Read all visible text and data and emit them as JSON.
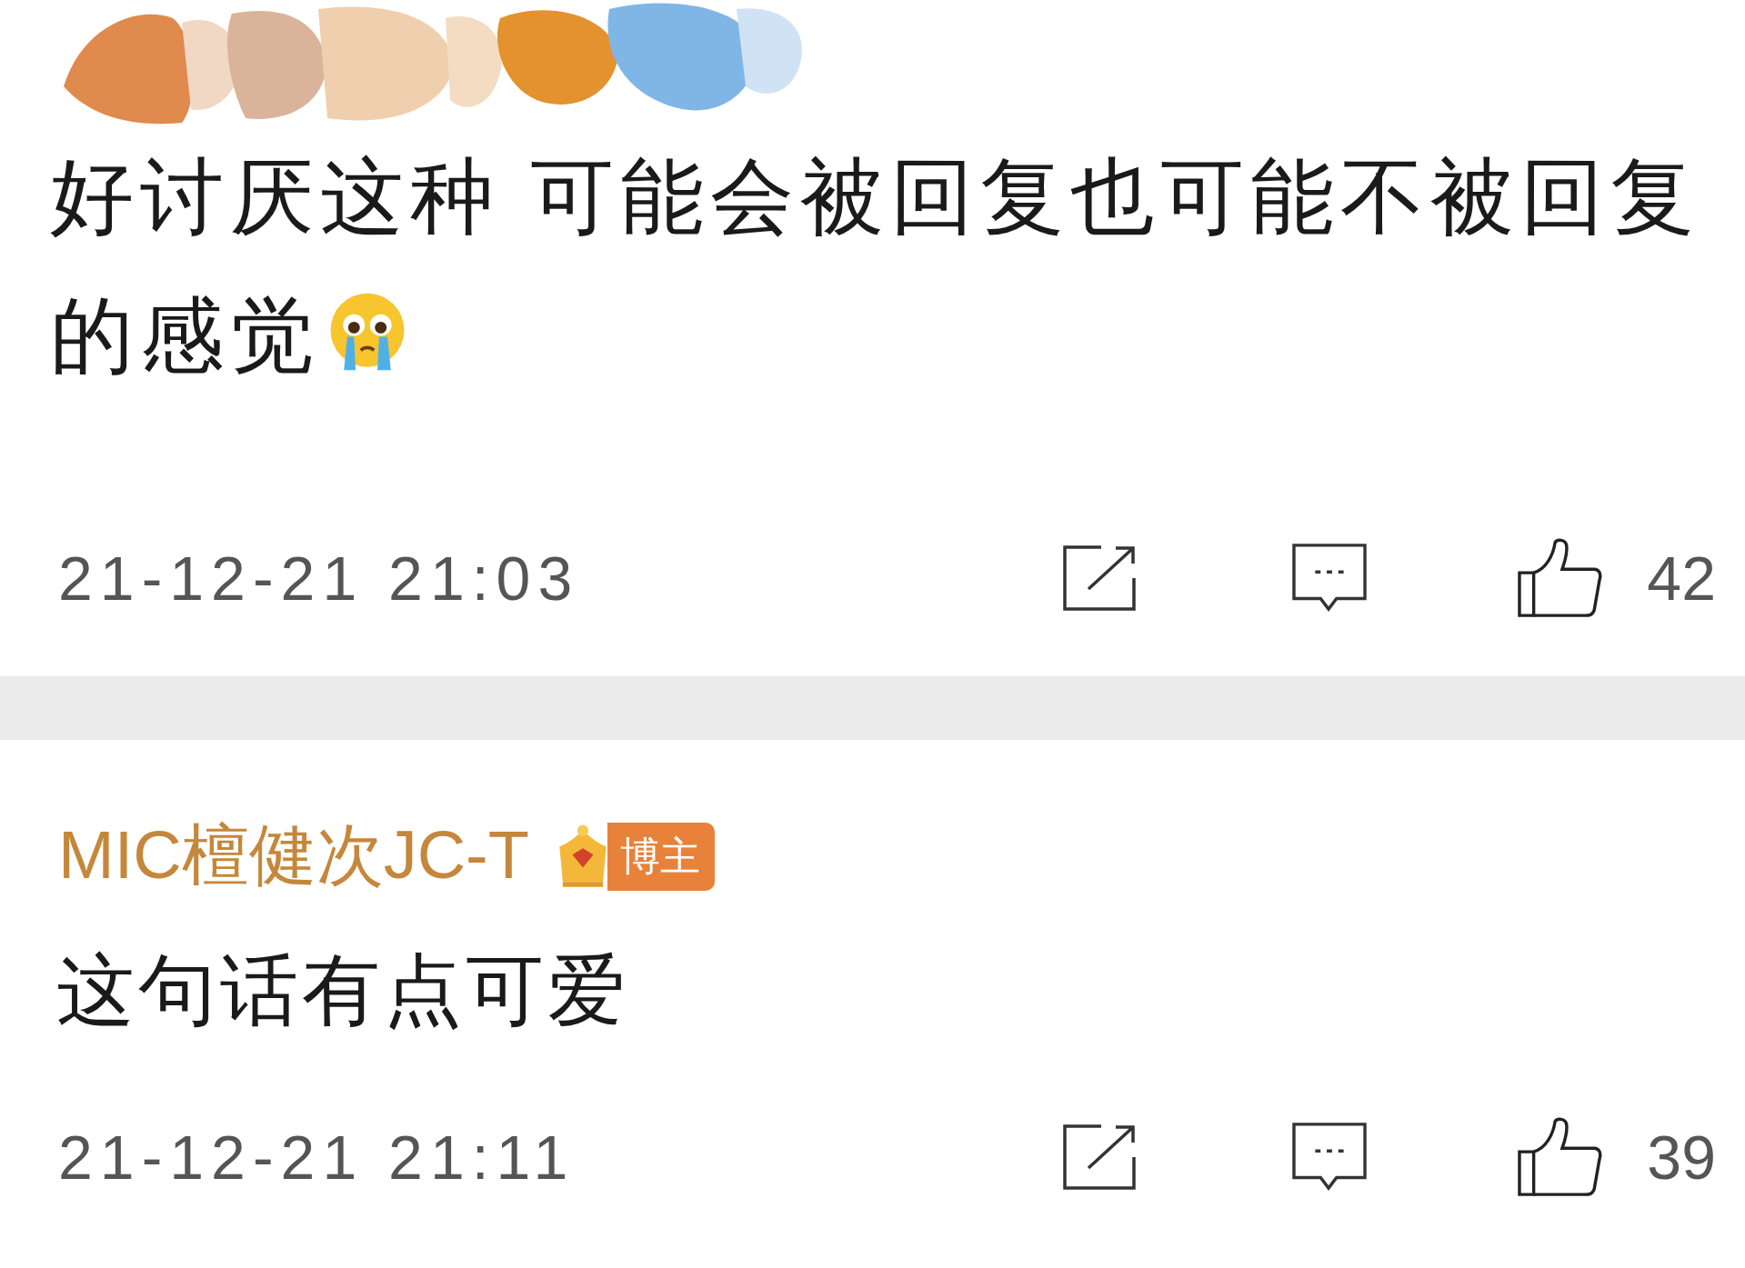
{
  "comments": [
    {
      "author_hidden": true,
      "text": "好讨厌这种 可能会被回复也可能不被回复的感觉",
      "crying_emoji": true,
      "time": "21-12-21 21:03",
      "likes": "42"
    },
    {
      "author_hidden": false,
      "author": "MIC檀健次JC-T",
      "badge": "博主",
      "text": "这句话有点可爱",
      "time": "21-12-21 21:11",
      "likes": "39"
    }
  ]
}
